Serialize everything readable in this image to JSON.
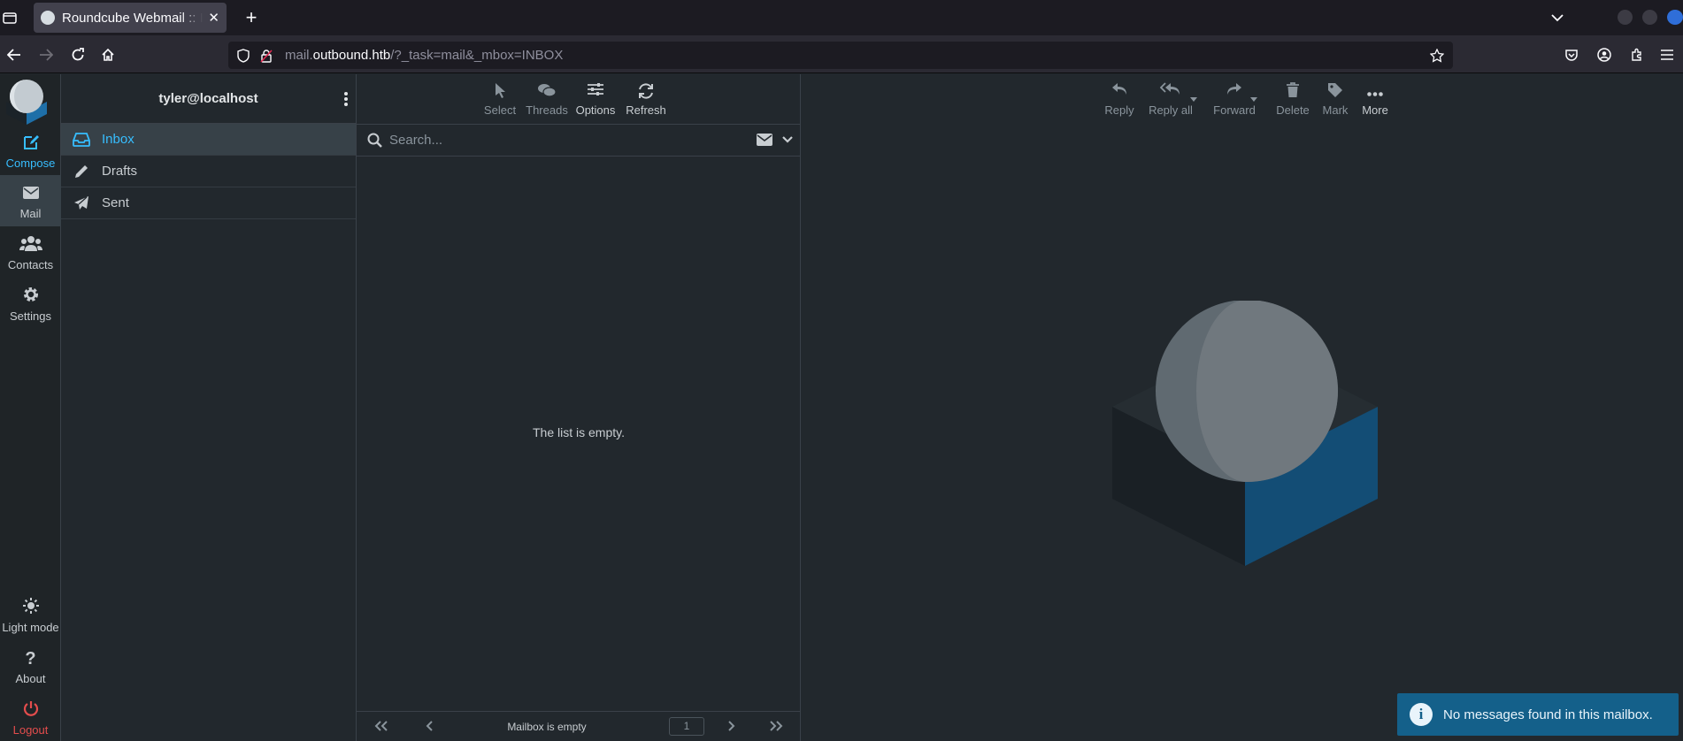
{
  "browser": {
    "tab_title": "Roundcube Webmail :: Inbox",
    "url_prefix": "mail.",
    "url_domain": "outbound.htb",
    "url_path": "/?_task=mail&_mbox=INBOX"
  },
  "taskmenu": {
    "compose": "Compose",
    "mail": "Mail",
    "contacts": "Contacts",
    "settings": "Settings",
    "light_mode": "Light mode",
    "about": "About",
    "logout": "Logout"
  },
  "folders": {
    "account": "tyler@localhost",
    "items": [
      {
        "label": "Inbox"
      },
      {
        "label": "Drafts"
      },
      {
        "label": "Sent"
      }
    ]
  },
  "list_toolbar": {
    "select": "Select",
    "threads": "Threads",
    "options": "Options",
    "refresh": "Refresh"
  },
  "search": {
    "placeholder": "Search..."
  },
  "list": {
    "empty_text": "The list is empty."
  },
  "pager": {
    "status": "Mailbox is empty",
    "page": "1"
  },
  "message_toolbar": {
    "reply": "Reply",
    "reply_all": "Reply all",
    "forward": "Forward",
    "delete": "Delete",
    "mark": "Mark",
    "more": "More"
  },
  "notification": {
    "text": "No messages found in this mailbox."
  },
  "colors": {
    "accent": "#37beff",
    "logout": "#e44d4d",
    "toast": "#14608a"
  }
}
